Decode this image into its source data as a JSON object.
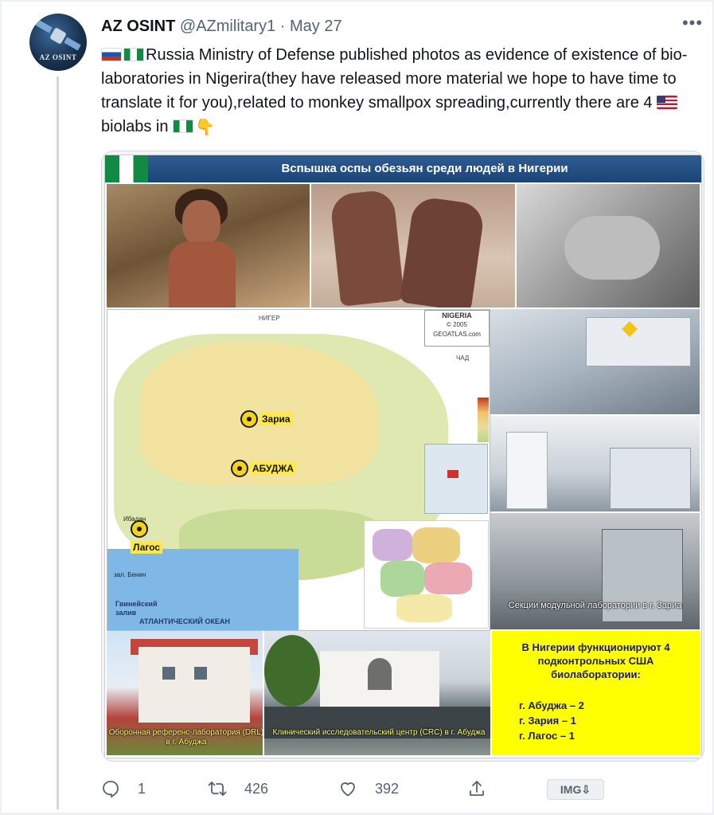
{
  "tweet": {
    "author_name": "AZ OSINT",
    "handle": "@AZmilitary1",
    "separator": " · ",
    "date": "May 27",
    "avatar_text": "AZ OSINT",
    "more_icon": "more-horizontal-icon",
    "text_part1": "Russia Ministry of Defense published photos as evidence of existence of bio-laboratories in Nigerira(they have released more material we hope to have time to translate it for you),related to monkey smallpox spreading,currently there are 4 ",
    "text_part2": "biolabs in ",
    "emojis": [
      "flag-russia",
      "flag-nigeria",
      "flag-united-states",
      "flag-nigeria",
      "backhand-index-pointing-down"
    ]
  },
  "image": {
    "title": "Вспышка оспы обезьян среди людей в Нигерии",
    "map": {
      "compass_title": "NIGERIA",
      "compass_sub": "© 2005 GEOATLAS.com",
      "cities": [
        {
          "name": "Зариа"
        },
        {
          "name": "АБУДЖА"
        },
        {
          "name": "Лагос"
        }
      ],
      "gulf_label": "Гвинейский\nзалив",
      "ocean_label": "АТЛАНТИЧЕСКИЙ ОКЕАН",
      "region_labels": [
        "НИГЕР",
        "ЧАД",
        "зал. Бенин",
        "Ибадан"
      ]
    },
    "lab_caption": "Секции модульной лаборатории в г. Зариа",
    "building1_caption": "Оборонная референс-лаборатория (DRL) в г. Абуджа",
    "building2_caption": "Клинический исследовательский центр (CRC) в г. Абуджа",
    "summary_title": "В Нигерии функционируют 4 подконтрольных США биолаборатории:",
    "summary_items": [
      "г. Абуджа – 2",
      "г. Зария – 1",
      "г. Лагос – 1"
    ]
  },
  "actions": {
    "reply_count": "1",
    "retweet_count": "426",
    "like_count": "392",
    "reply_icon": "reply-icon",
    "retweet_icon": "retweet-icon",
    "like_icon": "heart-icon",
    "share_icon": "share-icon",
    "img_button": "IMG⇩"
  },
  "colors": {
    "text": "#0f1419",
    "secondary": "#536471",
    "thread_line": "#cfd9de",
    "image_header": "#1c4477",
    "summary_box": "#ffff00"
  }
}
